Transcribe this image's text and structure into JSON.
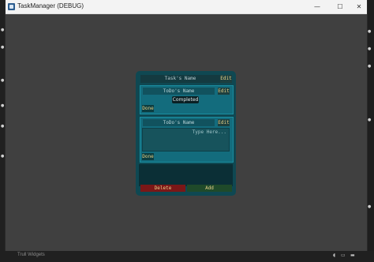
{
  "window": {
    "title": "TaskManager (DEBUG)",
    "minimize_glyph": "—",
    "maximize_glyph": "☐",
    "close_glyph": "✕"
  },
  "task": {
    "name_placeholder": "Task's Name",
    "edit_label": "Edit",
    "todos": [
      {
        "name_placeholder": "ToDo's Name",
        "edit_label": "Edit",
        "status_tooltip": "Completed",
        "done_label": "Done"
      },
      {
        "name_placeholder": "ToDo's Name",
        "edit_label": "Edit",
        "text_placeholder": "Type Here...",
        "done_label": "Done"
      }
    ],
    "delete_label": "Delete",
    "add_label": "Add"
  },
  "taskbar": {
    "text": "Trull Widgets"
  },
  "colors": {
    "card_bg": "#0f4852",
    "todo_bg": "#136c7d",
    "button_text": "#e9d48a",
    "delete_bg": "#7b1717",
    "add_bg": "#1f4a2a"
  }
}
